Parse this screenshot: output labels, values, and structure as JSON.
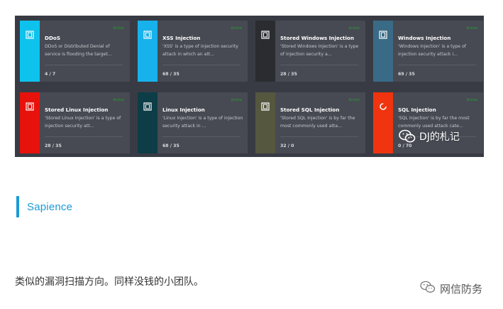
{
  "cards": [
    {
      "title": "DDoS",
      "desc_1": "DDoS or Distributed Denial of",
      "desc_2": "service is flooding the target...",
      "counts": "4 / 7",
      "accent": "#0ec2ee",
      "status": "Active",
      "icon": "document-icon"
    },
    {
      "title": "XSS Injection",
      "desc_1": "'XSS' is a type of injection security",
      "desc_2": "attack in which an att...",
      "counts": "68 / 35",
      "accent": "#17b2ec",
      "status": "Active",
      "icon": "document-icon"
    },
    {
      "title": "Stored Windows Injection",
      "desc_1": "'Stored Windows Injection' is a type",
      "desc_2": "of injection security a...",
      "counts": "28 / 35",
      "accent": "#2a2c30",
      "status": "Active",
      "icon": "document-icon"
    },
    {
      "title": "Windows Injection",
      "desc_1": "'Windows Injection' is a type of",
      "desc_2": "injection security attack i...",
      "counts": "69 / 35",
      "accent": "#3a6b86",
      "status": "Active",
      "icon": "document-icon"
    },
    {
      "title": "Stored Linux Injection",
      "desc_1": "'Stored Linux Injection' is a type of",
      "desc_2": "injection security att...",
      "counts": "28 / 35",
      "accent": "#e8120c",
      "status": "Active",
      "icon": "document-icon"
    },
    {
      "title": "Linux Injection",
      "desc_1": "'Linux Injection' is a type of injection",
      "desc_2": "security attack in ...",
      "counts": "68 / 35",
      "accent": "#0d3d47",
      "status": "Active",
      "icon": "document-icon"
    },
    {
      "title": "Stored SQL Injection",
      "desc_1": "'Stored SQL Injection' is by far the",
      "desc_2": "most commonly used atta...",
      "counts": "32 / 0",
      "accent": "#55573f",
      "status": "Active",
      "icon": "document-icon"
    },
    {
      "title": "SQL Injection",
      "desc_1": "'SQL Injection' is by far the most",
      "desc_2": "commonly used attack cate...",
      "counts": "0 / 70",
      "accent": "#f0340f",
      "status": "Active",
      "icon": "refresh-circle-icon"
    }
  ],
  "watermark_image": "DJ的札记",
  "section_title": "Sapience",
  "body_text": "类似的漏洞扫描方向。同样没钱的小团队。",
  "watermark_footer": "网信防务"
}
